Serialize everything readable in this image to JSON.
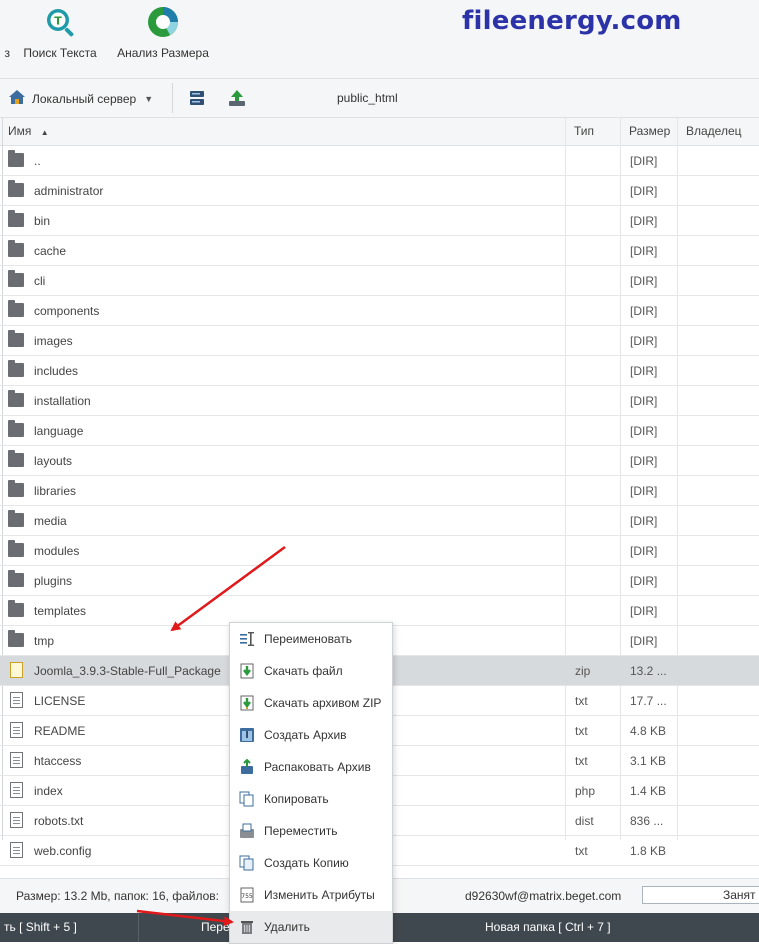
{
  "toolbar": {
    "partial_label": "з",
    "search_text": "Поиск Текста",
    "size_analysis": "Анализ Размера"
  },
  "brand": "fileenergy.com",
  "pathbar": {
    "server": "Локальный сервер",
    "path": "public_html"
  },
  "columns": {
    "name": "Имя",
    "type": "Тип",
    "size": "Размер",
    "owner": "Владелец"
  },
  "files": [
    {
      "name": "..",
      "type": "",
      "size": "[DIR]",
      "kind": "folder"
    },
    {
      "name": "administrator",
      "type": "",
      "size": "[DIR]",
      "kind": "folder"
    },
    {
      "name": "bin",
      "type": "",
      "size": "[DIR]",
      "kind": "folder"
    },
    {
      "name": "cache",
      "type": "",
      "size": "[DIR]",
      "kind": "folder"
    },
    {
      "name": "cli",
      "type": "",
      "size": "[DIR]",
      "kind": "folder"
    },
    {
      "name": "components",
      "type": "",
      "size": "[DIR]",
      "kind": "folder"
    },
    {
      "name": "images",
      "type": "",
      "size": "[DIR]",
      "kind": "folder"
    },
    {
      "name": "includes",
      "type": "",
      "size": "[DIR]",
      "kind": "folder"
    },
    {
      "name": "installation",
      "type": "",
      "size": "[DIR]",
      "kind": "folder"
    },
    {
      "name": "language",
      "type": "",
      "size": "[DIR]",
      "kind": "folder"
    },
    {
      "name": "layouts",
      "type": "",
      "size": "[DIR]",
      "kind": "folder"
    },
    {
      "name": "libraries",
      "type": "",
      "size": "[DIR]",
      "kind": "folder"
    },
    {
      "name": "media",
      "type": "",
      "size": "[DIR]",
      "kind": "folder"
    },
    {
      "name": "modules",
      "type": "",
      "size": "[DIR]",
      "kind": "folder"
    },
    {
      "name": "plugins",
      "type": "",
      "size": "[DIR]",
      "kind": "folder"
    },
    {
      "name": "templates",
      "type": "",
      "size": "[DIR]",
      "kind": "folder"
    },
    {
      "name": "tmp",
      "type": "",
      "size": "[DIR]",
      "kind": "folder"
    },
    {
      "name": "Joomla_3.9.3-Stable-Full_Package",
      "type": "zip",
      "size": "13.2 ...",
      "kind": "zip",
      "selected": true
    },
    {
      "name": "LICENSE",
      "type": "txt",
      "size": "17.7 ...",
      "kind": "file"
    },
    {
      "name": "README",
      "type": "txt",
      "size": "4.8 KB",
      "kind": "file"
    },
    {
      "name": "htaccess",
      "type": "txt",
      "size": "3.1 KB",
      "kind": "file"
    },
    {
      "name": "index",
      "type": "php",
      "size": "1.4 KB",
      "kind": "file"
    },
    {
      "name": "robots.txt",
      "type": "dist",
      "size": "836 ...",
      "kind": "file"
    },
    {
      "name": "web.config",
      "type": "txt",
      "size": "1.8 KB",
      "kind": "file"
    }
  ],
  "context_menu": [
    {
      "label": "Переименовать",
      "icon": "rename-icon"
    },
    {
      "label": "Скачать файл",
      "icon": "download-icon"
    },
    {
      "label": "Скачать архивом ZIP",
      "icon": "download-zip-icon"
    },
    {
      "label": "Создать Архив",
      "icon": "archive-icon"
    },
    {
      "label": "Распаковать Архив",
      "icon": "unpack-icon"
    },
    {
      "label": "Копировать",
      "icon": "copy-icon"
    },
    {
      "label": "Переместить",
      "icon": "move-icon"
    },
    {
      "label": "Создать Копию",
      "icon": "duplicate-icon"
    },
    {
      "label": "Изменить Атрибуты",
      "icon": "attributes-icon"
    },
    {
      "label": "Удалить",
      "icon": "trash-icon",
      "active": true
    }
  ],
  "status": {
    "summary": "Размер: 13.2 Mb, папок: 16, файлов:",
    "user": "d92630wf@matrix.beget.com",
    "disk": "Занят"
  },
  "bottom": {
    "b1": "ть [ Shift + 5 ]",
    "b2": "Пере",
    "b3": "Новая папка [ Ctrl + 7 ]"
  },
  "colors": {
    "brand": "#2c33a8",
    "arrow": "#e0191b",
    "bottombar": "#40484f"
  }
}
